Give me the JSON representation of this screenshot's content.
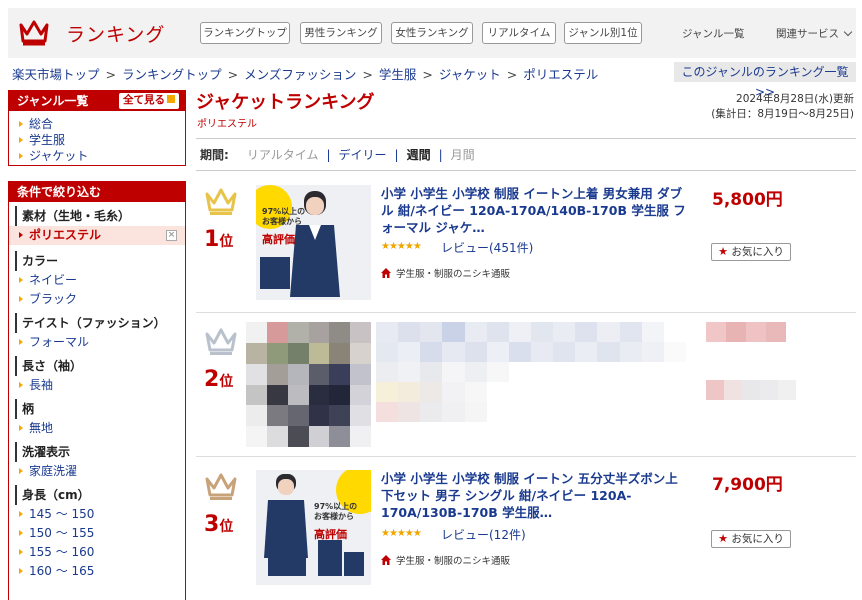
{
  "header": {
    "logo_text": "ランキング",
    "nav": [
      "ランキングトップ",
      "男性ランキング",
      "女性ランキング",
      "リアルタイム",
      "ジャンル別1位"
    ],
    "genre_list": "ジャンル一覧",
    "related_services": "関連サービス"
  },
  "breadcrumb": [
    "楽天市場トップ",
    "ランキングトップ",
    "メンズファッション",
    "学生服",
    "ジャケット",
    "ポリエステル"
  ],
  "breadcrumb_sep": ">",
  "genre_ranking_list_link": "このジャンルのランキング一覧 >>",
  "sidebar": {
    "genre_title": "ジャンル一覧",
    "see_all": "全て見る",
    "genres": [
      "総合",
      "学生服",
      "ジャケット"
    ],
    "filter_title": "条件で絞り込む",
    "groups": [
      {
        "title": "素材（生地・毛糸）",
        "items": [
          "ポリエステル"
        ]
      },
      {
        "title": "カラー",
        "items": [
          "ネイビー",
          "ブラック"
        ]
      },
      {
        "title": "テイスト（ファッション）",
        "items": [
          "フォーマル"
        ]
      },
      {
        "title": "長さ（袖）",
        "items": [
          "長袖"
        ]
      },
      {
        "title": "柄",
        "items": [
          "無地"
        ]
      },
      {
        "title": "洗濯表示",
        "items": [
          "家庭洗濯"
        ]
      },
      {
        "title": "身長（cm）",
        "items": [
          "145 ～ 150",
          "150 ～ 155",
          "155 ～ 160",
          "160 ～ 165"
        ]
      }
    ],
    "selected_remove": "×"
  },
  "main": {
    "title": "ジャケットランキング",
    "subtitle": "ポリエステル",
    "date_line1": "2024年8月28日(水)更新",
    "date_line2": "(集計日：8月19日～8月25日)",
    "period_label": "期間:",
    "periods": [
      "リアルタイム",
      "デイリー",
      "週間",
      "月間"
    ],
    "period_sep": "|",
    "rank_suffix": "位",
    "stars": "★★★★★",
    "fav_label": "お気に入り",
    "items": [
      {
        "rank": "1",
        "title": "小学 小学生 小学校 制服 イートン上着 男女兼用 ダブル 紺/ネイビー 120A-170A/140B-170B 学生服 フォーマル ジャケ…",
        "review": "レビュー(451件)",
        "shop": "学生服・制服のニシキ通販",
        "price": "5,800円",
        "thumb_badge_line1": "97%以上の",
        "thumb_badge_line2": "お客様から",
        "thumb_badge_line3": "高評価"
      },
      {
        "rank": "2"
      },
      {
        "rank": "3",
        "title": "小学 小学生 小学校 制服 イートン 五分丈半ズボン上下セット 男子 シングル 紺/ネイビー 120A-170A/130B-170B 学生服…",
        "review": "レビュー(12件)",
        "shop": "学生服・制服のニシキ通販",
        "price": "7,900円",
        "thumb_badge_line1": "97%以上の",
        "thumb_badge_line2": "お客様から",
        "thumb_badge_line3": "高評価"
      }
    ]
  },
  "colors": {
    "accent": "#bf0000",
    "link": "#1a3a8f",
    "star": "#f0a500",
    "bullet": "#f6a800"
  }
}
